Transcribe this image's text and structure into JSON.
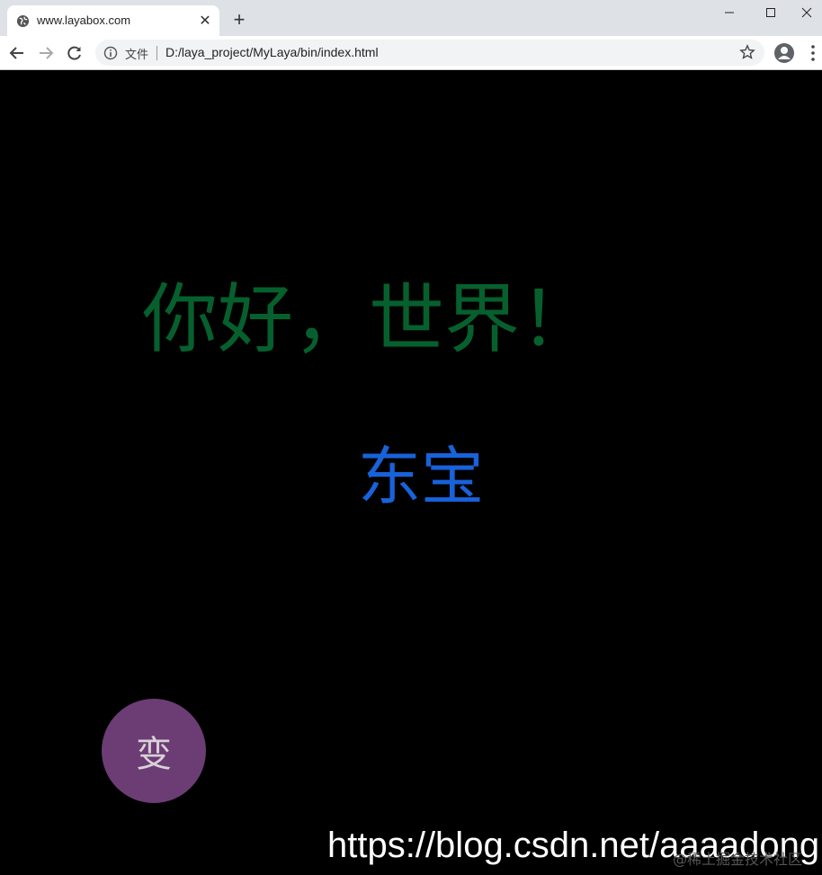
{
  "browser": {
    "tab_title": "www.layabox.com",
    "tab_close": "✕",
    "new_tab": "+",
    "security_label": "文件",
    "url": "D:/laya_project/MyLaya/bin/index.html"
  },
  "icons": {
    "tab": "globe-icon",
    "back": "arrow-left-icon",
    "forward": "arrow-right-icon",
    "reload": "reload-icon",
    "info": "info-icon",
    "bookmark": "star-icon",
    "profile": "account-icon",
    "menu": "kebab-menu-icon"
  },
  "stage": {
    "greeting": "你好，世界！",
    "name": "东宝",
    "button_label": "变"
  },
  "overlay": {
    "blog_url": "https://blog.csdn.net/aaaadong",
    "tag": "@稀土掘金技术社区"
  },
  "colors": {
    "greeting": "#06602d",
    "name": "#1862da",
    "button": "#6c3c74",
    "background": "#000000"
  }
}
